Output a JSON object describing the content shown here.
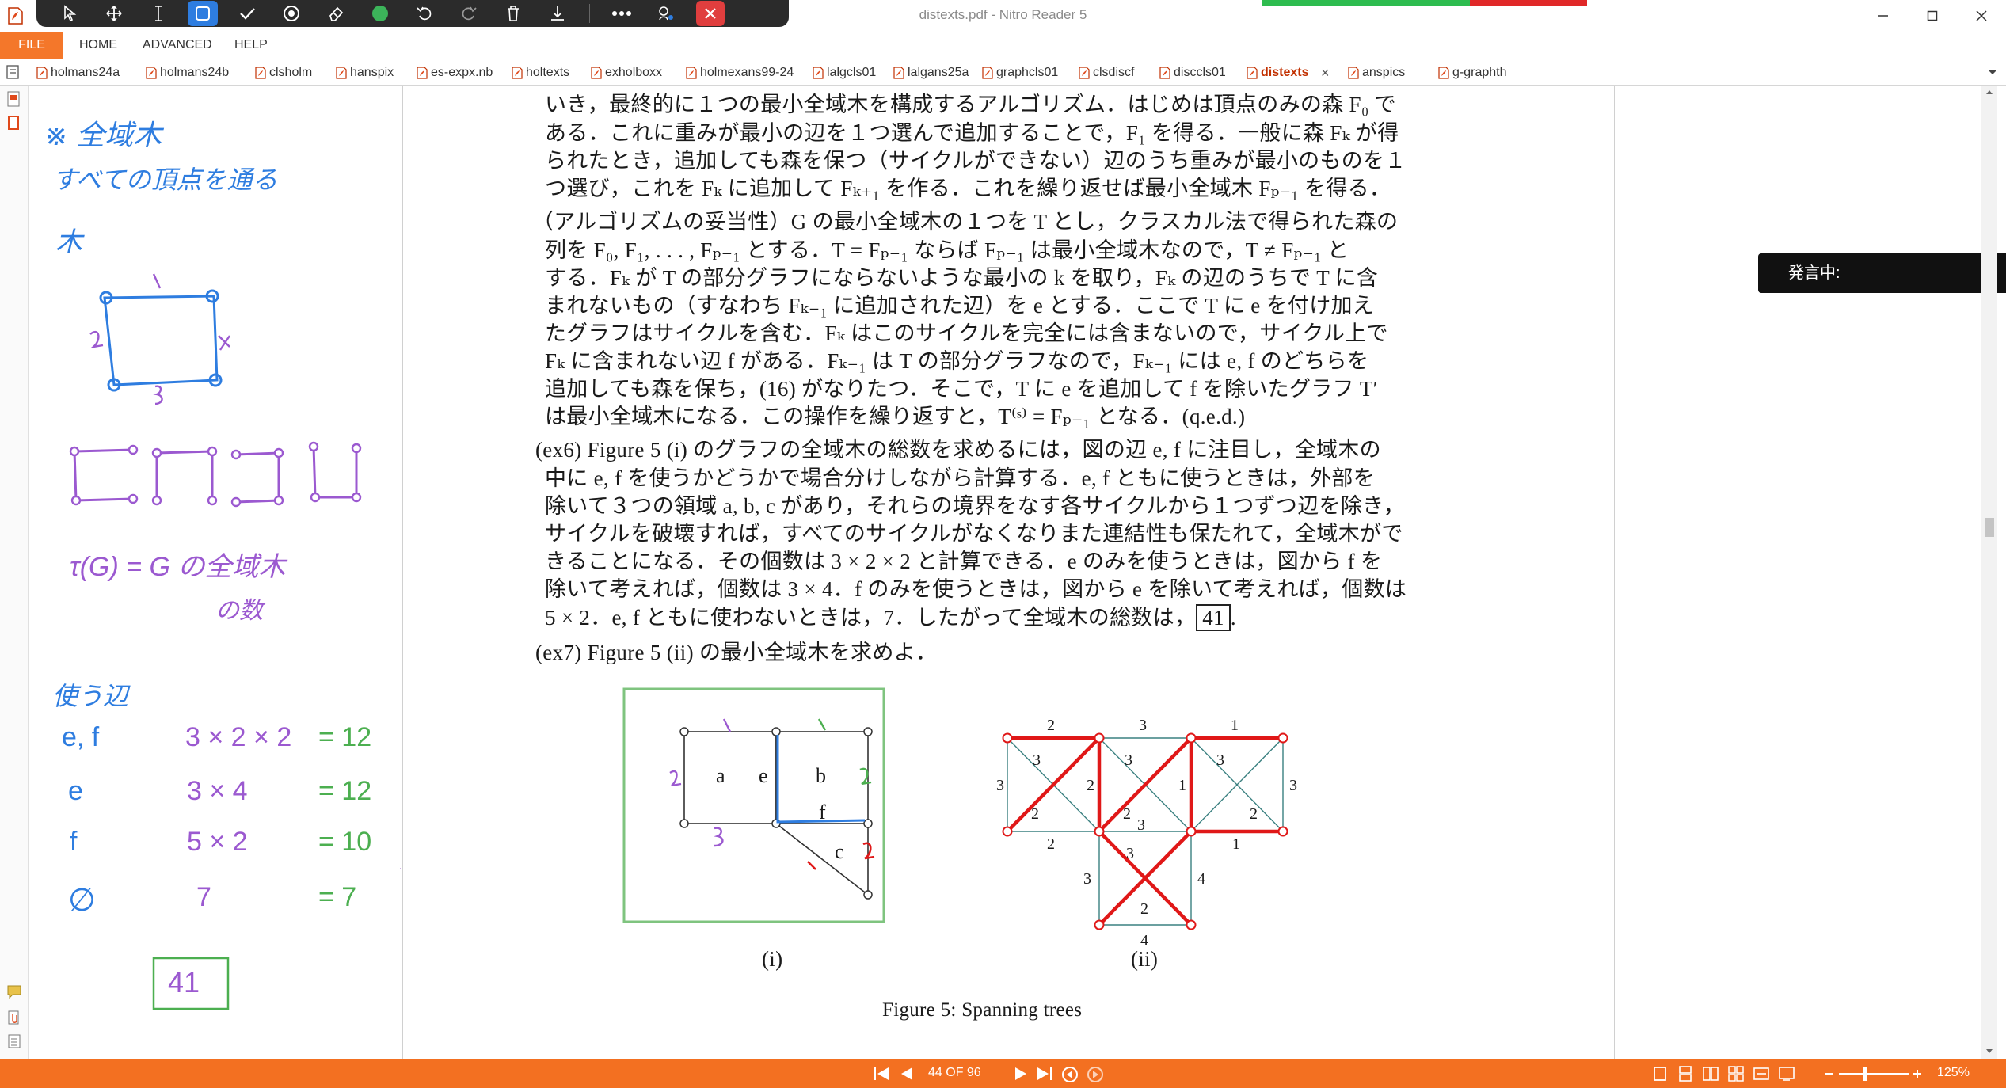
{
  "window": {
    "title": "distexts.pdf - Nitro Reader 5",
    "controls": [
      "minimize",
      "maximize",
      "close"
    ]
  },
  "pen_toolbar": {
    "tools": [
      "select-arrow-icon",
      "pan-icon",
      "text-cursor-icon",
      "rectangle-icon",
      "checkmark-icon",
      "target-icon",
      "eraser-icon",
      "color-dot-icon",
      "undo-icon",
      "redo-icon",
      "trash-icon",
      "download-icon",
      "more-icon",
      "pen-settings-icon",
      "close-icon"
    ],
    "accent": "#2e7de0",
    "dot_color": "#3cb45a",
    "close_color": "#e03e3e"
  },
  "ribbon": {
    "tabs": [
      "FILE",
      "HOME",
      "ADVANCED",
      "HELP"
    ],
    "file_color": "#f4772a"
  },
  "doc_tabs": [
    "holmans24a",
    "holmans24b",
    "clsholm",
    "hanspix",
    "es-expx.nb",
    "holtexts",
    "exholboxx",
    "holmexans99-24",
    "lalgcls01",
    "lalgans25a",
    "graphcls01",
    "clsdiscf",
    "disccls01",
    "distexts",
    "anspics",
    "g-graphth"
  ],
  "active_tab": "distexts",
  "speech_box": {
    "label": "発言中:"
  },
  "document": {
    "lines": [
      "いき，最終的に１つの最小全域木を構成するアルゴリズム．はじめは頂点のみの森 F₀ で",
      "ある．これに重みが最小の辺を１つ選んで追加することで，F₁ を得る．一般に森 Fₖ が得",
      "られたとき，追加しても森を保つ（サイクルができない）辺のうち重みが最小のものを１",
      "つ選び，これを Fₖ に追加して Fₖ₊₁ を作る．これを繰り返せば最小全域木 Fₚ₋₁ を得る．",
      "（アルゴリズムの妥当性）G の最小全域木の１つを T とし，クラスカル法で得られた森の",
      "列を F₀, F₁, . . . , Fₚ₋₁ とする．T = Fₚ₋₁ ならば Fₚ₋₁ は最小全域木なので，T ≠ Fₚ₋₁ と",
      "する．Fₖ が T の部分グラフにならないような最小の k を取り，Fₖ の辺のうちで T に含",
      "まれないもの（すなわち Fₖ₋₁ に追加された辺）を e とする．ここで T に e を付け加え",
      "たグラフはサイクルを含む．Fₖ はこのサイクルを完全には含まないので，サイクル上で",
      "Fₖ に含まれない辺 f がある．Fₖ₋₁ は T の部分グラフなので，Fₖ₋₁ には e, f のどちらを",
      "追加しても森を保ち，(16) がなりたつ．そこで，T に e を追加して f を除いたグラフ T′",
      "は最小全域木になる．この操作を繰り返すと，T⁽ˢ⁾ = Fₚ₋₁ となる．(q.e.d.)",
      "(ex6) Figure 5 (i) のグラフの全域木の総数を求めるには，図の辺 e, f に注目し，全域木の",
      "中に e, f を使うかどうかで場合分けしながら計算する．e, f ともに使うときは，外部を",
      "除いて３つの領域 a, b, c があり，それらの境界をなす各サイクルから１つずつ辺を除き，",
      "サイクルを破壊すれば，すべてのサイクルがなくなりまた連結性も保たれて，全域木がで",
      "きることになる．その個数は 3 × 2 × 2 と計算できる．e のみを使うときは，図から f を",
      "除いて考えれば，個数は 3 × 4．f のみを使うときは，図から e を除いて考えれば，個数は",
      "5 × 2．e, f ともに使わないときは，7．したがって全域木の総数は，",
      "(ex7) Figure 5 (ii) の最小全域木を求めよ．"
    ],
    "answer_box": "41",
    "answer_suffix": ".",
    "figure1": {
      "region_labels": [
        "a",
        "b",
        "c"
      ],
      "edge_labels": [
        "e",
        "f"
      ],
      "caption": "(i)",
      "frame_color": "#7fc47f"
    },
    "figure2": {
      "weights": [
        "2",
        "3",
        "1",
        "3",
        "3",
        "3",
        "2",
        "1",
        "3",
        "3",
        "2",
        "2",
        "2",
        "1",
        "3",
        "3",
        "4",
        "3",
        "2",
        "4",
        "2"
      ],
      "caption": "(ii)",
      "highlight_color": "#e01818",
      "edge_color": "#3a8080"
    },
    "figure_caption": "Figure 5: Spanning trees"
  },
  "ink_notes": {
    "title_lines": [
      "※ 全域木",
      "すべての頂点を通る",
      "木"
    ],
    "formula": "τ(G) = G の全域木",
    "formula_2": "の数",
    "case_heading": "使う辺",
    "cases": [
      {
        "name": "e, f",
        "calc": "3 × 2 × 2",
        "result": "= 12"
      },
      {
        "name": "e",
        "calc": "3 × 4",
        "result": "= 12"
      },
      {
        "name": "f",
        "calc": "5 × 2",
        "result": "= 10"
      },
      {
        "name": "∅",
        "calc": "7",
        "result": "= 7"
      }
    ],
    "total": "41",
    "blue": "#2e7de0",
    "purple": "#9b59d0",
    "green": "#4caf50",
    "red": "#e01818"
  },
  "status": {
    "page": "44 OF 96",
    "zoom": "125%",
    "bar_color": "#f37021"
  }
}
